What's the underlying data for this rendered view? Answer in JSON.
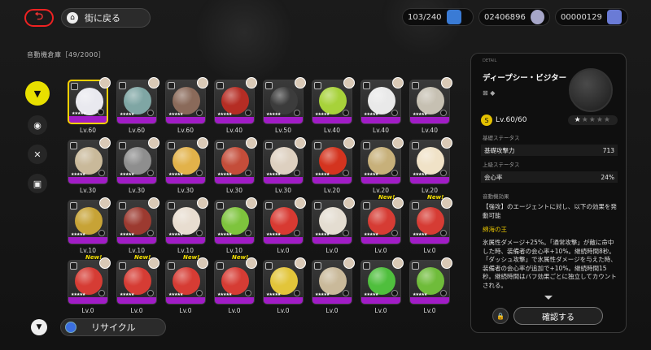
{
  "topbar": {
    "back_icon": "back-arrow-icon",
    "town_label": "街に戻る",
    "energy": "103/240",
    "dennies": "02406896",
    "polychrome": "00000129"
  },
  "store": {
    "title": "音動機倉庫［49/2000］"
  },
  "nav": [
    {
      "icon": "filter-icon"
    },
    {
      "icon": "disc-icon"
    },
    {
      "icon": "dismantle-icon"
    },
    {
      "icon": "bangboo-icon"
    }
  ],
  "cards": [
    {
      "lv": "Lv.60",
      "color": "#e9e9ef",
      "new": false,
      "sel": true
    },
    {
      "lv": "Lv.60",
      "color": "#7fa6a4",
      "new": false,
      "sel": false
    },
    {
      "lv": "Lv.60",
      "color": "#8a6a5a",
      "new": false,
      "sel": false
    },
    {
      "lv": "Lv.40",
      "color": "#b52d24",
      "new": false,
      "sel": false
    },
    {
      "lv": "Lv.50",
      "color": "#3c3c3c",
      "new": false,
      "sel": false
    },
    {
      "lv": "Lv.40",
      "color": "#a7d23a",
      "new": false,
      "sel": false
    },
    {
      "lv": "Lv.40",
      "color": "#e9e9e9",
      "new": false,
      "sel": false
    },
    {
      "lv": "Lv.40",
      "color": "#c6c0b2",
      "new": false,
      "sel": false
    },
    {
      "lv": "Lv.30",
      "color": "#c9b99a",
      "new": false,
      "sel": false
    },
    {
      "lv": "Lv.30",
      "color": "#8e8e8e",
      "new": false,
      "sel": false
    },
    {
      "lv": "Lv.30",
      "color": "#e2b24a",
      "new": false,
      "sel": false
    },
    {
      "lv": "Lv.30",
      "color": "#c44d3a",
      "new": false,
      "sel": false
    },
    {
      "lv": "Lv.30",
      "color": "#ddd0c0",
      "new": false,
      "sel": false
    },
    {
      "lv": "Lv.20",
      "color": "#d4341f",
      "new": false,
      "sel": false
    },
    {
      "lv": "Lv.20",
      "color": "#c7b07a",
      "new": false,
      "sel": false
    },
    {
      "lv": "Lv.20",
      "color": "#f0e2c7",
      "new": false,
      "sel": false
    },
    {
      "lv": "Lv.10",
      "color": "#c7a336",
      "new": false,
      "sel": false
    },
    {
      "lv": "Lv.10",
      "color": "#9c3a30",
      "new": false,
      "sel": false
    },
    {
      "lv": "Lv.10",
      "color": "#e8ddd0",
      "new": false,
      "sel": false
    },
    {
      "lv": "Lv.10",
      "color": "#7ec43d",
      "new": false,
      "sel": false
    },
    {
      "lv": "Lv.0",
      "color": "#d83a32",
      "new": false,
      "sel": false
    },
    {
      "lv": "Lv.0",
      "color": "#e4ddd1",
      "new": false,
      "sel": false
    },
    {
      "lv": "Lv.0",
      "color": "#d63c34",
      "new": true,
      "sel": false
    },
    {
      "lv": "Lv.0",
      "color": "#d63c34",
      "new": true,
      "sel": false
    },
    {
      "lv": "Lv.0",
      "color": "#d63c34",
      "new": true,
      "sel": false
    },
    {
      "lv": "Lv.0",
      "color": "#d63c34",
      "new": true,
      "sel": false
    },
    {
      "lv": "Lv.0",
      "color": "#d63c34",
      "new": true,
      "sel": false
    },
    {
      "lv": "Lv.0",
      "color": "#d63c34",
      "new": true,
      "sel": false
    },
    {
      "lv": "Lv.0",
      "color": "#e2c53a",
      "new": false,
      "sel": false
    },
    {
      "lv": "Lv.0",
      "color": "#c9b99a",
      "new": false,
      "sel": false
    },
    {
      "lv": "Lv.0",
      "color": "#4fbf3d",
      "new": false,
      "sel": false
    },
    {
      "lv": "Lv.0",
      "color": "#6fbc3a",
      "new": false,
      "sel": false
    }
  ],
  "new_label": "New!",
  "bottom": {
    "filter_icon": "triangle-down-icon",
    "recycle_label": "リサイクル"
  },
  "detail": {
    "tag": "DETAIL",
    "name": "ディープシー・ビジター",
    "level": "Lv.60/60",
    "stars_filled": "★",
    "stars_empty": "★★★★",
    "base_section": "基礎ステータス",
    "base_stat_name": "基礎攻撃力",
    "base_stat_value": "713",
    "adv_section": "上級ステータス",
    "adv_stat_name": "会心率",
    "adv_stat_value": "24%",
    "effect_section": "音動機効果",
    "effect_intro": "【強攻】のエージェントに対し、以下の効果を発動可能",
    "effect_name": "綿海の王",
    "effect_line1": "氷属性ダメージ+25%。「通常攻撃」が敵に命中した時、装備者の会心率+10%。継続時間8秒。「ダッシュ攻撃」で氷属性ダメージを与えた時、装備者の会心率が追加で+10%。継続時間15秒。継続時間はバフ効果ごとに独立してカウントされる。",
    "confirm_label": "確認する"
  }
}
